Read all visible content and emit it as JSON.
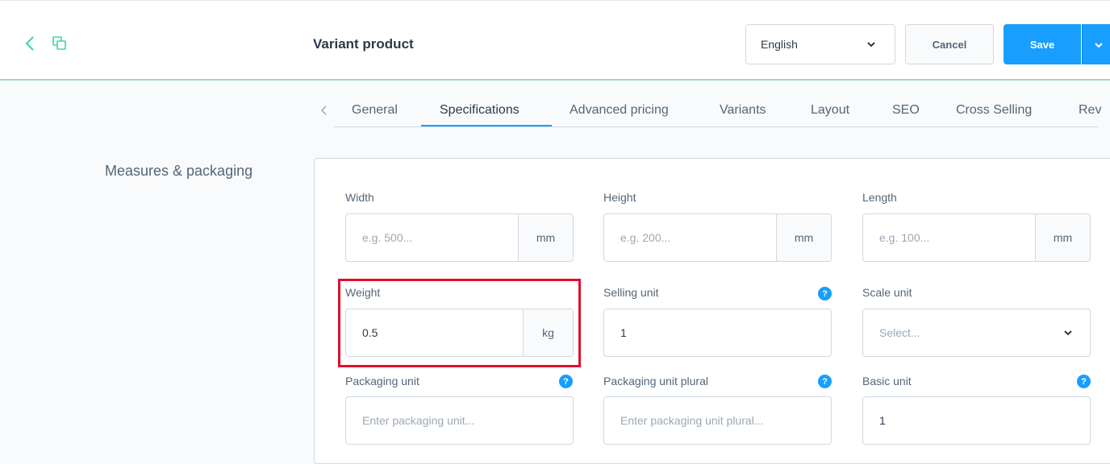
{
  "header": {
    "title": "Variant product",
    "language": "English",
    "cancel_label": "Cancel",
    "save_label": "Save",
    "accent_color": "#37d6a1",
    "primary_color": "#189eff"
  },
  "tabs": [
    {
      "label": "General"
    },
    {
      "label": "Specifications",
      "active": true
    },
    {
      "label": "Advanced pricing"
    },
    {
      "label": "Variants"
    },
    {
      "label": "Layout"
    },
    {
      "label": "SEO"
    },
    {
      "label": "Cross Selling"
    },
    {
      "label": "Rev"
    }
  ],
  "section": {
    "title": "Measures & packaging",
    "fields": {
      "width": {
        "label": "Width",
        "placeholder": "e.g. 500...",
        "unit": "mm"
      },
      "height": {
        "label": "Height",
        "placeholder": "e.g. 200...",
        "unit": "mm"
      },
      "length": {
        "label": "Length",
        "placeholder": "e.g. 100...",
        "unit": "mm"
      },
      "weight": {
        "label": "Weight",
        "value": "0.5",
        "unit": "kg"
      },
      "selling_unit": {
        "label": "Selling unit",
        "value": "1"
      },
      "scale_unit": {
        "label": "Scale unit",
        "placeholder": "Select..."
      },
      "packaging_unit": {
        "label": "Packaging unit",
        "placeholder": "Enter packaging unit..."
      },
      "packaging_unit_plural": {
        "label": "Packaging unit plural",
        "placeholder": "Enter packaging unit plural..."
      },
      "basic_unit": {
        "label": "Basic unit",
        "value": "1"
      }
    },
    "help_glyph": "?",
    "highlight_color": "#e0102b"
  }
}
